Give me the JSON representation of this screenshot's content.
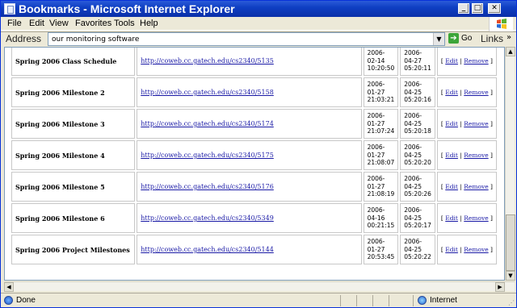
{
  "window": {
    "title": "Bookmarks - Microsoft Internet Explorer",
    "minimize": "_",
    "maximize": "□",
    "close": "✕"
  },
  "menu": [
    "File",
    "Edit",
    "View",
    "Favorites",
    "Tools",
    "Help"
  ],
  "address": {
    "label": "Address",
    "value": "our monitoring software",
    "go_label": "Go",
    "links_label": "Links"
  },
  "bookmarks": [
    {
      "name": "Spring 2006 Class Schedule",
      "url": "http://coweb.cc.gatech.edu/cs2340/5135",
      "created": "2006-02-14 10:20:50",
      "modified": "2006-04-27 05:20:11"
    },
    {
      "name": "Spring 2006 Milestone 2",
      "url": "http://coweb.cc.gatech.edu/cs2340/5158",
      "created": "2006-01-27 21:03:21",
      "modified": "2006-04-25 05:20:16"
    },
    {
      "name": "Spring 2006 Milestone 3",
      "url": "http://coweb.cc.gatech.edu/cs2340/5174",
      "created": "2006-01-27 21:07:24",
      "modified": "2006-04-25 05:20:18"
    },
    {
      "name": "Spring 2006 Milestone 4",
      "url": "http://coweb.cc.gatech.edu/cs2340/5175",
      "created": "2006-01-27 21:08:07",
      "modified": "2006-04-25 05:20:20"
    },
    {
      "name": "Spring 2006 Milestone 5",
      "url": "http://coweb.cc.gatech.edu/cs2340/5176",
      "created": "2006-01-27 21:08:19",
      "modified": "2006-04-25 05:20:26"
    },
    {
      "name": "Spring 2006 Milestone 6",
      "url": "http://coweb.cc.gatech.edu/cs2340/5349",
      "created": "2006-04-16 00:21:15",
      "modified": "2006-04-25 05:20:17"
    },
    {
      "name": "Spring 2006 Project Milestones",
      "url": "http://coweb.cc.gatech.edu/cs2340/5144",
      "created": "2006-01-27 20:53:45",
      "modified": "2006-04-25 05:20:22"
    }
  ],
  "actions": {
    "edit": "Edit",
    "remove": "Remove",
    "open": "[",
    "sep": "|",
    "close": "]"
  },
  "status": {
    "text": "Done",
    "zone": "Internet"
  },
  "colors": {
    "title_bar": "#0f3fc3",
    "link": "#1a1aa6",
    "chrome": "#ece9d8"
  },
  "icons": [
    "ie-page-icon",
    "windows-logo-icon",
    "go-arrow-icon",
    "done-page-icon",
    "internet-zone-icon"
  ]
}
